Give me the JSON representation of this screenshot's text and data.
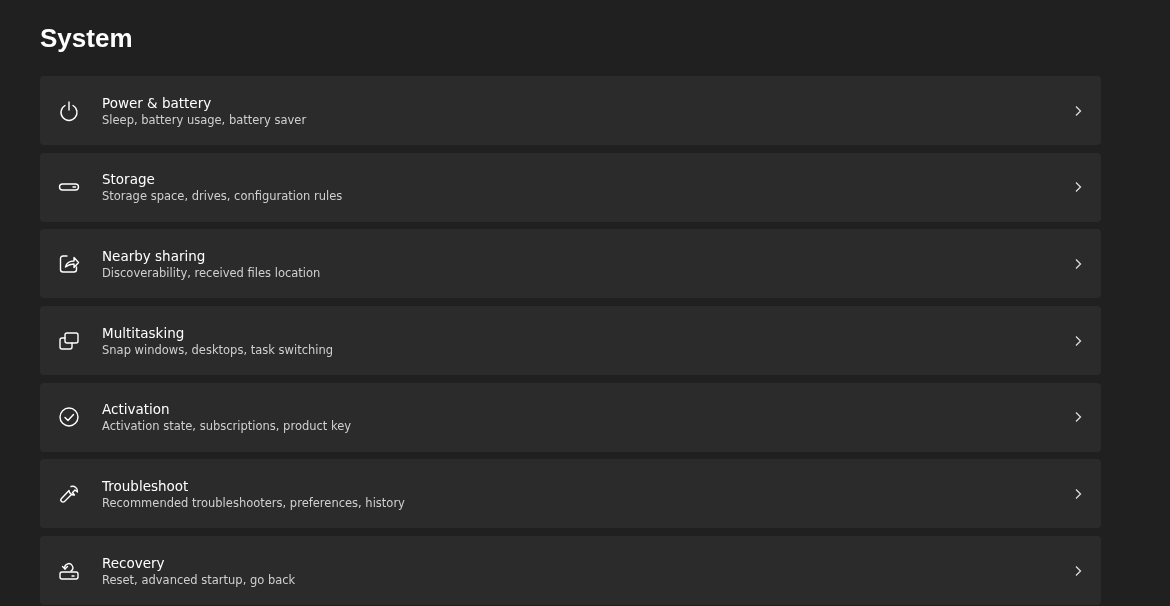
{
  "page": {
    "title": "System"
  },
  "items": [
    {
      "kind": "power",
      "title": "Power & battery",
      "subtitle": "Sleep, battery usage, battery saver"
    },
    {
      "kind": "storage",
      "title": "Storage",
      "subtitle": "Storage space, drives, configuration rules"
    },
    {
      "kind": "share",
      "title": "Nearby sharing",
      "subtitle": "Discoverability, received files location"
    },
    {
      "kind": "multitask",
      "title": "Multitasking",
      "subtitle": "Snap windows, desktops, task switching"
    },
    {
      "kind": "activation",
      "title": "Activation",
      "subtitle": "Activation state, subscriptions, product key"
    },
    {
      "kind": "troubleshoot",
      "title": "Troubleshoot",
      "subtitle": "Recommended troubleshooters, preferences, history"
    },
    {
      "kind": "recovery",
      "title": "Recovery",
      "subtitle": "Reset, advanced startup, go back"
    }
  ]
}
